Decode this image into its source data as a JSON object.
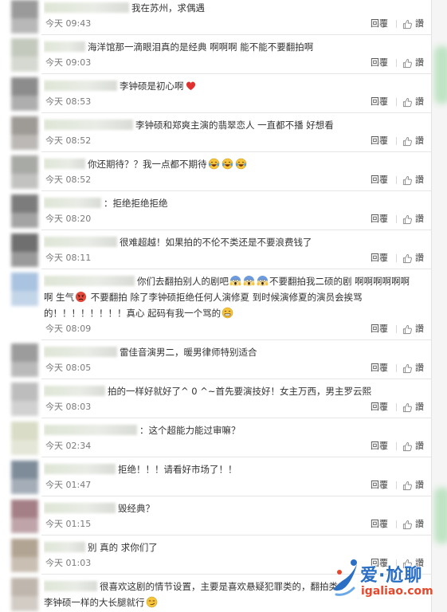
{
  "colors": {
    "text": "#333333",
    "meta": "#7a7a7a",
    "action": "#444444",
    "divider": "#e6e6e6",
    "watermark_brand": "#2a6fc4",
    "watermark_url": "#e5492d"
  },
  "actions": {
    "reply_label": "回覆",
    "like_icon": "thumbs-up-icon",
    "like_label": "讚"
  },
  "comments": [
    {
      "avatar_color": "#9a9a9a",
      "lines": [
        [
          "我在苏州，求偶遇"
        ]
      ],
      "time": "今天 09:43"
    },
    {
      "avatar_color": "#c4c9be",
      "lines": [
        [
          "海洋馆那一滴眼泪真的是经典 啊啊啊 能不能不要翻拍啊"
        ]
      ],
      "time": "今天 09:03"
    },
    {
      "avatar_color": "#8c8c8c",
      "lines": [
        [
          "李钟硕是初心啊",
          {
            "icon": "heart-icon"
          }
        ]
      ],
      "time": "今天 08:53"
    },
    {
      "avatar_color": "#9e9a96",
      "lines": [
        [
          "李钟硕和郑爽主演的翡翠恋人 一直都不播 好想看"
        ]
      ],
      "time": "今天 08:52"
    },
    {
      "avatar_color": "#a8aaa6",
      "lines": [
        [
          "你还期待？？我一点都不期待",
          {
            "icon": "laughing-emoji"
          },
          {
            "icon": "laughing-emoji"
          },
          {
            "icon": "laughing-emoji"
          }
        ]
      ],
      "time": "今天 08:52"
    },
    {
      "avatar_color": "#7c7c7c",
      "lines": [
        [
          "：拒绝拒绝拒绝"
        ]
      ],
      "time": "今天 08:20"
    },
    {
      "avatar_color": "#6f6f6f",
      "lines": [
        [
          "很难超越！如果拍的不伦不类还是不要浪费钱了"
        ]
      ],
      "time": "今天 08:11"
    },
    {
      "avatar_color": "#a9c3e0",
      "lines": [
        [
          "你们去翻拍别人的剧吧",
          {
            "icon": "scream-emoji"
          },
          {
            "icon": "scream-emoji"
          },
          {
            "icon": "scream-emoji"
          },
          "不要翻拍我二硕的剧 啊啊啊啊啊啊"
        ],
        [
          "啊 生气",
          {
            "icon": "angry-emoji"
          },
          " 不要翻拍 除了李钟硕拒绝任何人演修夏 到时候演修夏的演员会挨骂"
        ],
        [
          "的！！！！！！！！真心 起码有我一个骂的",
          {
            "icon": "grin-emoji"
          }
        ]
      ],
      "time": "今天 08:09"
    },
    {
      "avatar_color": "#9c9c9c",
      "lines": [
        [
          "雷佳音演男二，暖男律师特别适合"
        ]
      ],
      "time": "今天 08:05"
    },
    {
      "avatar_color": "#bdbdbd",
      "lines": [
        [
          "拍的一样好就好了^ 0 ^~首先要演技好！女主万西，男主罗云熙"
        ]
      ],
      "time": "今天 08:03"
    },
    {
      "avatar_color": "#d9dcc6",
      "lines": [
        [
          "：这个超能力能过审嘛？"
        ]
      ],
      "time": "今天 02:34"
    },
    {
      "avatar_color": "#7e8c9a",
      "lines": [
        [
          "拒绝！！！请看好市场了！！"
        ]
      ],
      "time": "今天 01:47"
    },
    {
      "avatar_color": "#a47f86",
      "lines": [
        [
          "毁经典？"
        ]
      ],
      "time": "今天 01:15"
    },
    {
      "avatar_color": "#b2a493",
      "lines": [
        [
          "别 真的 求你们了"
        ]
      ],
      "time": "今天 01:03"
    },
    {
      "avatar_color": "#bfb6ad",
      "lines": [
        [
          "很喜欢这剧的情节设置，主要是喜欢悬疑犯罪类的，翻拍类"
        ],
        [
          "李钟硕一样的大长腿就行",
          {
            "icon": "smirk-emoji"
          }
        ]
      ]
    }
  ],
  "watermark": {
    "logo_icon": "igaliao-logo-icon",
    "brand": "爱·尬聊",
    "url": "igaliao.com"
  }
}
